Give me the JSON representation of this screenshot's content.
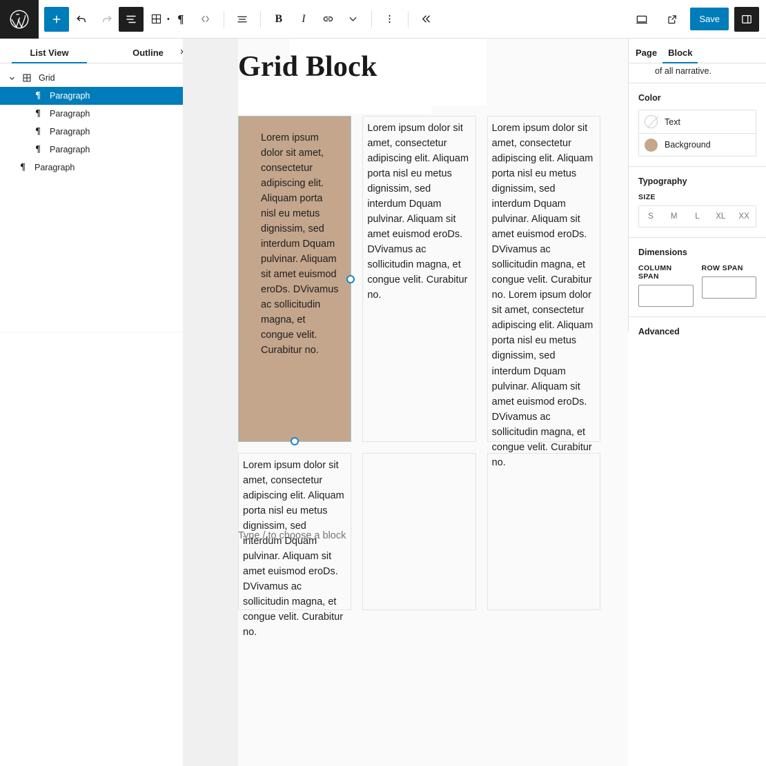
{
  "toolbar": {
    "logo_icon": "wordpress-logo-icon",
    "buttons": [
      {
        "name": "add-block-button",
        "icon": "plus-icon",
        "label": "+"
      },
      {
        "name": "undo-button",
        "icon": "undo-arrow-icon",
        "label": ""
      },
      {
        "name": "redo-button",
        "icon": "redo-arrow-icon",
        "label": ""
      },
      {
        "name": "list-view-button",
        "icon": "list-view-icon",
        "label": ""
      },
      {
        "name": "block-type-grid-button",
        "icon": "grid-block-icon",
        "label": ""
      },
      {
        "name": "paragraph-transform-button",
        "icon": "pilcrow-icon",
        "label": "¶"
      },
      {
        "name": "move-block-button",
        "icon": "chevron-left-right-icon",
        "label": ""
      },
      {
        "name": "align-button",
        "icon": "align-text-icon",
        "label": ""
      },
      {
        "name": "bold-button",
        "icon": "bold-icon",
        "label": "B"
      },
      {
        "name": "italic-button",
        "icon": "italic-icon",
        "label": "I"
      },
      {
        "name": "link-button",
        "icon": "link-icon",
        "label": ""
      },
      {
        "name": "more-rich-text-button",
        "icon": "chevron-down-icon",
        "label": ""
      },
      {
        "name": "block-options-button",
        "icon": "vertical-dots-icon",
        "label": ""
      },
      {
        "name": "collapse-toolbar-button",
        "icon": "double-chevron-left-icon",
        "label": "«"
      }
    ],
    "view_icon": "desktop-preview-icon",
    "external_icon": "external-link-icon",
    "save_label": "Save",
    "settings_icon": "settings-sidebar-icon",
    "accent_color": "#007cba",
    "dark_color": "#1e1e1e"
  },
  "list_view": {
    "tabs": [
      {
        "label": "List View",
        "active": true
      },
      {
        "label": "Outline",
        "active": false
      }
    ],
    "close_icon": "close-icon",
    "close_label": "×",
    "items": [
      {
        "label": "Grid",
        "icon": "grid-block-icon",
        "depth": 0,
        "expanded": true,
        "selected": false
      },
      {
        "label": "Paragraph",
        "icon": "pilcrow-icon",
        "depth": 1,
        "selected": true,
        "more_label": "⋮"
      },
      {
        "label": "Paragraph",
        "icon": "pilcrow-icon",
        "depth": 1,
        "selected": false
      },
      {
        "label": "Paragraph",
        "icon": "pilcrow-icon",
        "depth": 1,
        "selected": false
      },
      {
        "label": "Paragraph",
        "icon": "pilcrow-icon",
        "depth": 1,
        "selected": false
      },
      {
        "label": "Paragraph",
        "icon": "pilcrow-icon",
        "depth": 0,
        "selected": false
      }
    ]
  },
  "editor": {
    "post_title": "Grid Block",
    "placeholder_text": "Type / to choose a block",
    "selected_cell_bg": "#c4a68c",
    "cells": [
      {
        "name": "grid-cell-1",
        "selected": true,
        "text": "Lorem ipsum dolor sit amet, consectetur adipiscing elit. Aliquam porta nisl eu metus dignissim, sed interdum Dquam pulvinar. Aliquam sit amet euismod eroDs. DVivamus ac sollicitudin magna, et congue velit. Curabitur no."
      },
      {
        "name": "grid-cell-2",
        "selected": false,
        "text": "Lorem ipsum dolor sit amet, consectetur adipiscing elit. Aliquam porta nisl eu metus dignissim, sed interdum Dquam pulvinar. Aliquam sit amet euismod eroDs. DVivamus ac sollicitudin magna, et congue velit. Curabitur no."
      },
      {
        "name": "grid-cell-3",
        "selected": false,
        "text": "Lorem ipsum dolor sit amet, consectetur adipiscing elit. Aliquam porta nisl eu metus dignissim, sed interdum Dquam pulvinar. Aliquam sit amet euismod eroDs. DVivamus ac sollicitudin magna, et congue velit. Curabitur no. Lorem ipsum dolor sit amet, consectetur adipiscing elit. Aliquam porta nisl eu metus dignissim, sed interdum Dquam pulvinar. Aliquam sit amet euismod eroDs. DVivamus ac sollicitudin magna, et congue velit. Curabitur no."
      },
      {
        "name": "grid-cell-4",
        "selected": false,
        "text": "Lorem ipsum dolor sit amet, consectetur adipiscing elit. Aliquam porta nisl eu metus dignissim, sed interdum Dquam pulvinar. Aliquam sit amet euismod eroDs. DVivamus ac sollicitudin magna, et congue velit. Curabitur no."
      },
      {
        "name": "grid-cell-5",
        "selected": false,
        "text": ""
      },
      {
        "name": "grid-cell-6",
        "selected": false,
        "text": ""
      }
    ]
  },
  "sidebar": {
    "tabs": [
      {
        "label": "Page",
        "active": false
      },
      {
        "label": "Block",
        "active": true
      }
    ],
    "clipped_text": "of all narrative.",
    "color": {
      "heading": "Color",
      "rows": [
        {
          "label": "Text",
          "swatch": "none",
          "icon": "no-color-icon"
        },
        {
          "label": "Background",
          "swatch": "#c4a68c",
          "icon": "color-swatch-icon"
        }
      ]
    },
    "typography": {
      "heading": "Typography",
      "size_label": "SIZE",
      "sizes": [
        "S",
        "M",
        "L",
        "XL",
        "XX"
      ]
    },
    "dimensions": {
      "heading": "Dimensions",
      "column_span_label": "COLUMN SPAN",
      "row_span_label": "ROW SPAN",
      "column_span_value": "",
      "row_span_value": ""
    },
    "advanced_label": "Advanced"
  }
}
